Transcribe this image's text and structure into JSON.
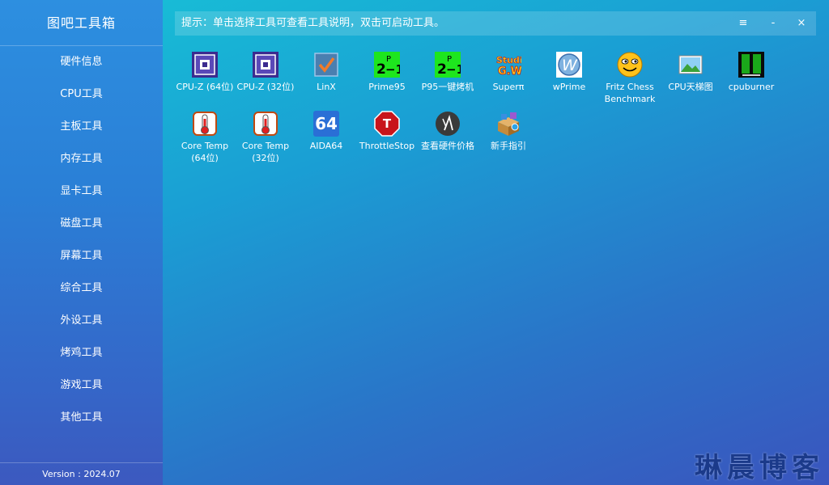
{
  "app": {
    "title": "图吧工具箱",
    "version": "Version : 2024.07"
  },
  "sidebar": {
    "items": [
      {
        "label": "硬件信息"
      },
      {
        "label": "CPU工具"
      },
      {
        "label": "主板工具"
      },
      {
        "label": "内存工具"
      },
      {
        "label": "显卡工具"
      },
      {
        "label": "磁盘工具"
      },
      {
        "label": "屏幕工具"
      },
      {
        "label": "综合工具"
      },
      {
        "label": "外设工具"
      },
      {
        "label": "烤鸡工具"
      },
      {
        "label": "游戏工具"
      },
      {
        "label": "其他工具"
      }
    ]
  },
  "header": {
    "hint": "提示：单击选择工具可查看工具说明，双击可启动工具。",
    "menu_icon": "≡",
    "minimize_icon": "-",
    "close_icon": "×"
  },
  "tools": [
    {
      "label": "CPU-Z (64位)",
      "icon": "cpu-chip-icon"
    },
    {
      "label": "CPU-Z (32位)",
      "icon": "cpu-chip-icon"
    },
    {
      "label": "LinX",
      "icon": "checkbox-icon"
    },
    {
      "label": "Prime95",
      "icon": "prime95-icon"
    },
    {
      "label": "P95一键烤机",
      "icon": "prime95-icon"
    },
    {
      "label": "Superπ",
      "icon": "superpi-icon"
    },
    {
      "label": "wPrime",
      "icon": "wprime-icon"
    },
    {
      "label": "Fritz Chess Benchmark",
      "icon": "smiley-icon"
    },
    {
      "label": "CPU天梯图",
      "icon": "picture-icon"
    },
    {
      "label": "cpuburner",
      "icon": "cpuburner-icon"
    },
    {
      "label": "Core Temp (64位)",
      "icon": "thermometer-icon"
    },
    {
      "label": "Core Temp (32位)",
      "icon": "thermometer-icon"
    },
    {
      "label": "AIDA64",
      "icon": "aida64-icon",
      "text": "64"
    },
    {
      "label": "ThrottleStop",
      "icon": "stop-sign-icon",
      "text": "T"
    },
    {
      "label": "查看硬件价格",
      "icon": "price-icon"
    },
    {
      "label": "新手指引",
      "icon": "package-icon"
    }
  ],
  "watermark": "琳晨博客"
}
